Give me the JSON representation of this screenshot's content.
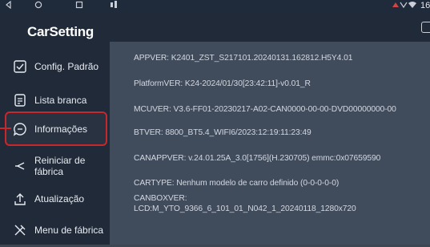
{
  "app": {
    "title": "CarSetting"
  },
  "statusbar": {
    "left_icons": [
      "back-icon",
      "home-icon",
      "recents-icon"
    ],
    "right_text": "16"
  },
  "sidebar": {
    "items": [
      {
        "label": "Config. Padrão",
        "icon": "check-square-icon"
      },
      {
        "label": "Lista branca",
        "icon": "clipboard-list-icon"
      },
      {
        "label": "Informações",
        "icon": "chat-bubble-icon",
        "active": true
      },
      {
        "label": "Reiniciar de fábrica",
        "label_line1": "Reiniciar de",
        "label_line2": "fábrica",
        "icon": "restart-icon"
      },
      {
        "label": "Atualização",
        "icon": "upload-icon"
      },
      {
        "label": "Menu de fábrica",
        "icon": "tools-icon"
      }
    ]
  },
  "info": {
    "appver": "APPVER: K2401_ZST_S217101.20240131.162812.H5Y4.01",
    "platformver": "PlatformVER: K24-2024/01/30[23:42:11]-v0.01_R",
    "mcuver": "MCUVER: V3.6-FF01-20230217-A02-CAN0000-00-00-DVD00000000-00",
    "btver": "BTVER: 8800_BT5.4_WIFI6/2023:12:19:11:23:49",
    "canappver": "CANAPPVER: v.24.01.25A_3.0[1756](H.230705)  emmc:0x07659590",
    "cartype": "CARTYPE: Nenhum modelo de carro definido  (0-0-0-0-0)",
    "canboxver_line1": "CANBOXVER:",
    "canboxver_line2": "LCD:M_YTO_9366_6_101_01_N042_1_20240118_1280x720"
  },
  "colors": {
    "sidebar_bg": "#202a39",
    "content_bg": "#404b5b",
    "active_border": "#c8272b",
    "text_light": "#d2d8e2"
  }
}
